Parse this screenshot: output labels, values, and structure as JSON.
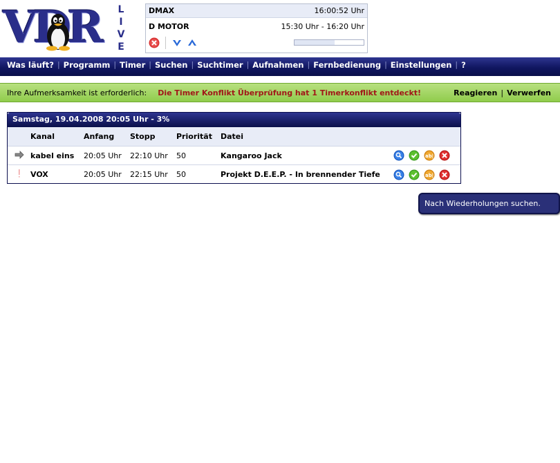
{
  "logo": {
    "text": "VDR",
    "side_text": "LIVE"
  },
  "infobox": {
    "channel": "DMAX",
    "time": "16:00:52 Uhr",
    "program": "D MOTOR",
    "program_time": "15:30 Uhr - 16:20 Uhr",
    "progress_percent": 58
  },
  "nav": {
    "items": [
      "Was läuft?",
      "Programm",
      "Timer",
      "Suchen",
      "Suchtimer",
      "Aufnahmen",
      "Fernbedienung",
      "Einstellungen",
      "?"
    ],
    "separator": "|"
  },
  "alert": {
    "label": "Ihre Aufmerksamkeit ist erforderlich:",
    "message": "Die Timer Konflikt Überprüfung hat 1 Timerkonflikt entdeckt!",
    "action_react": "Reagieren",
    "separator": "|",
    "action_dismiss": "Verwerfen"
  },
  "timers": {
    "title": "Samstag, 19.04.2008 20:05 Uhr - 3%",
    "columns": [
      "Kanal",
      "Anfang",
      "Stopp",
      "Priorität",
      "Datei"
    ],
    "rows": [
      {
        "marker": "arrow-right-icon",
        "channel": "kabel eins",
        "start": "20:05 Uhr",
        "stop": "22:10 Uhr",
        "priority": "50",
        "file": "Kangaroo Jack"
      },
      {
        "marker": "exclamation-icon",
        "channel": "VOX",
        "start": "20:05 Uhr",
        "stop": "22:15 Uhr",
        "priority": "50",
        "file": "Projekt D.E.E.P. - In brennender Tiefe"
      }
    ]
  },
  "tooltip": {
    "text": "Nach Wiederholungen suchen."
  },
  "colors": {
    "nav_dark": "#0a0f4a",
    "alert_green": "#90cc4c",
    "alert_text": "#a01818"
  }
}
